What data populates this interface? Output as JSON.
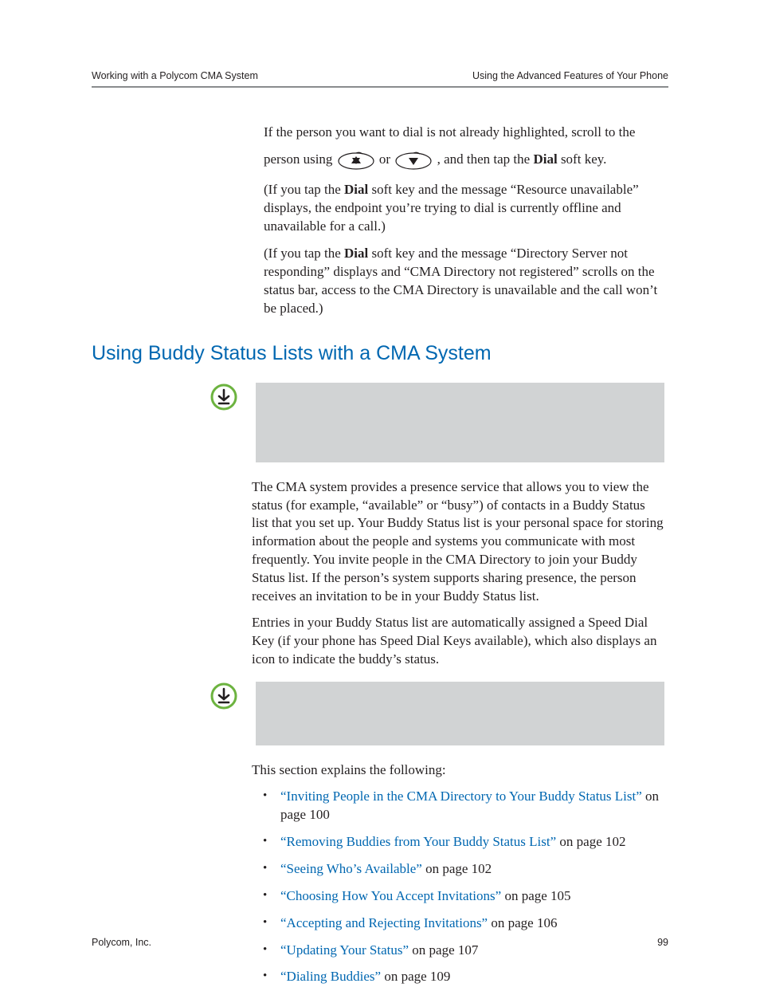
{
  "header": {
    "left": "Working with a Polycom CMA System",
    "right": "Using the Advanced Features of Your Phone"
  },
  "intro": {
    "p1_a": "If the person you want to dial is not already highlighted, scroll to the ",
    "p1_b": "person using ",
    "p1_c": " or ",
    "p1_d": " , and then tap the ",
    "p1_e": "Dial",
    "p1_f": " soft key.",
    "p2_a": "(If you tap the ",
    "p2_b": "Dial",
    "p2_c": " soft key and the message “Resource unavailable” displays, the endpoint you’re trying to dial is currently offline and unavailable for a call.)",
    "p3_a": "(If you tap the ",
    "p3_b": "Dial",
    "p3_c": " soft key and the message “Directory Server not responding” displays and “CMA Directory not registered” scrolls on the status bar, access to the CMA Directory is unavailable and the call won’t be placed.)"
  },
  "section_heading": "Using Buddy Status Lists with a CMA System",
  "body": {
    "p1": "The CMA system provides a presence service that allows you to view the status (for example, “available” or “busy”) of contacts in a Buddy Status list that you set up. Your Buddy Status list is your personal space for storing information about the people and systems you communicate with most frequently. You invite people in the CMA Directory to join your Buddy Status list. If the person’s system supports sharing presence, the person receives an invitation to be in your Buddy Status list.",
    "p2": "Entries in your Buddy Status list are automatically assigned a Speed Dial Key (if your phone has Speed Dial Keys available), which also displays an icon to indicate the buddy’s status.",
    "p3": "This section explains the following:"
  },
  "toc": [
    {
      "link": "“Inviting People in the CMA Directory to Your Buddy Status List”",
      "tail": " on page 100"
    },
    {
      "link": "“Removing Buddies from Your Buddy Status List”",
      "tail": " on page 102"
    },
    {
      "link": "“Seeing Who’s Available”",
      "tail": " on page 102"
    },
    {
      "link": "“Choosing How You Accept Invitations”",
      "tail": " on page 105"
    },
    {
      "link": "“Accepting and Rejecting Invitations”",
      "tail": " on page 106"
    },
    {
      "link": "“Updating Your Status”",
      "tail": " on page 107"
    },
    {
      "link": "“Dialing Buddies”",
      "tail": " on page 109"
    }
  ],
  "footer": {
    "left": "Polycom, Inc.",
    "right": "99"
  }
}
